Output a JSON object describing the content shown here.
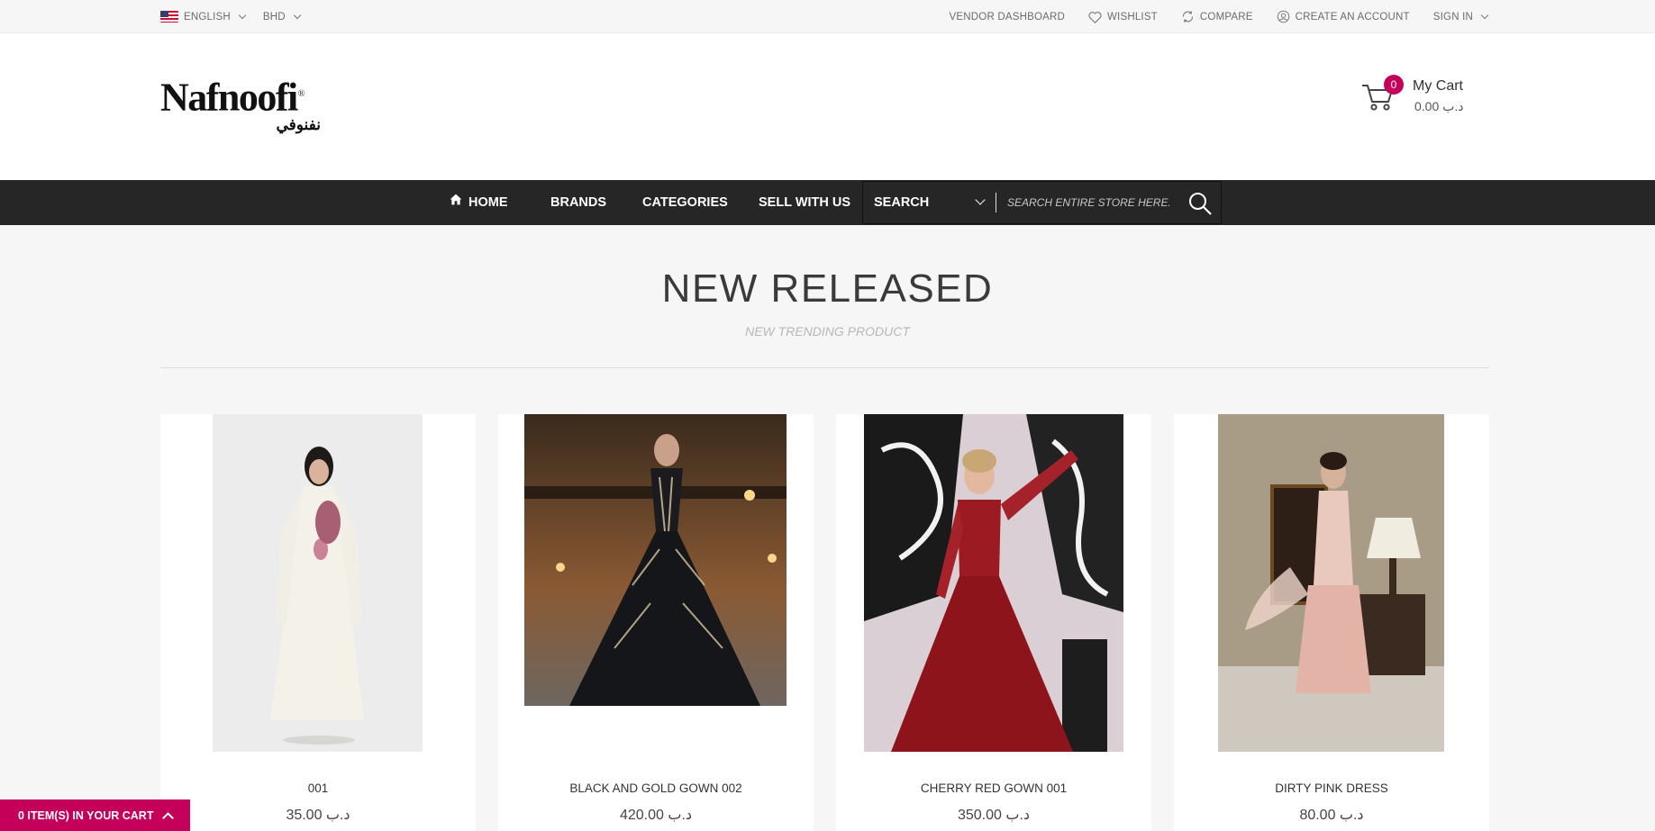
{
  "topbar": {
    "language": "ENGLISH",
    "currency": "BHD",
    "links": {
      "vendor_dashboard": "VENDOR DASHBOARD",
      "wishlist": "WISHLIST",
      "compare": "COMPARE",
      "create_account": "CREATE AN ACCOUNT",
      "sign_in": "SIGN IN"
    }
  },
  "header": {
    "logo_latin": "Nafnoofi",
    "logo_arabic": "نفنوفي",
    "cart": {
      "count": "0",
      "title": "My Cart",
      "amount": "0.00 د.ب"
    }
  },
  "nav": {
    "items": [
      "HOME",
      "BRANDS",
      "CATEGORIES",
      "SELL WITH US"
    ],
    "search_category": "SEARCH",
    "search_placeholder": "SEARCH ENTIRE STORE HERE..."
  },
  "section": {
    "title": "NEW RELEASED",
    "subtitle": "NEW TRENDING PRODUCT"
  },
  "products": [
    {
      "name": "001",
      "price": "35.00 د.ب"
    },
    {
      "name": "BLACK AND GOLD GOWN 002",
      "price": "420.00 د.ب"
    },
    {
      "name": "CHERRY RED GOWN 001",
      "price": "350.00 د.ب"
    },
    {
      "name": "DIRTY PINK DRESS",
      "price": "80.00 د.ب"
    }
  ],
  "cart_strip": {
    "label": "0 ITEM(S) IN YOUR CART"
  },
  "colors": {
    "accent": "#c4005a",
    "nav_bg": "#262626",
    "page_bg": "#f6f6f6"
  }
}
